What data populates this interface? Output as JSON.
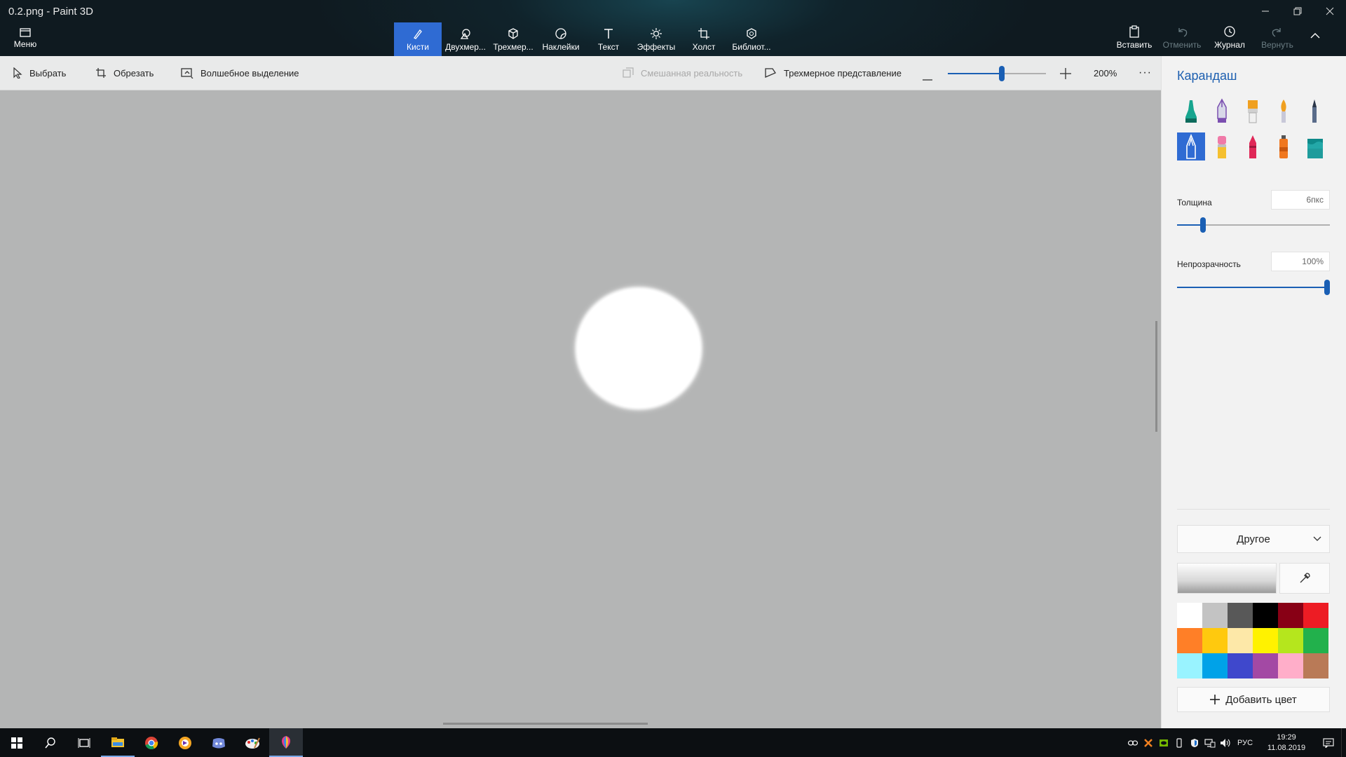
{
  "window": {
    "title": "0.2.png - Paint 3D"
  },
  "menu": {
    "label": "Меню"
  },
  "tabs": [
    {
      "label": "Кисти",
      "icon": "brush-icon",
      "active": true
    },
    {
      "label": "Двухмер...",
      "icon": "2d-shapes-icon"
    },
    {
      "label": "Трехмер...",
      "icon": "3d-shapes-icon"
    },
    {
      "label": "Наклейки",
      "icon": "stickers-icon"
    },
    {
      "label": "Текст",
      "icon": "text-icon"
    },
    {
      "label": "Эффекты",
      "icon": "effects-icon"
    },
    {
      "label": "Холст",
      "icon": "canvas-icon"
    },
    {
      "label": "Библиот...",
      "icon": "library-icon"
    }
  ],
  "commands": {
    "paste": "Вставить",
    "undo": "Отменить",
    "history": "Журнал",
    "redo": "Вернуть"
  },
  "toolbar": {
    "select": "Выбрать",
    "crop": "Обрезать",
    "magic_select": "Волшебное выделение",
    "mixed_reality": "Смешанная реальность",
    "view_3d": "Трехмерное представление",
    "zoom": "200%",
    "zoom_level": 0.55
  },
  "panel": {
    "title": "Карандаш",
    "thickness_label": "Толщина",
    "thickness_value": "6пкс",
    "thickness_level": 0.17,
    "opacity_label": "Непрозрачность",
    "opacity_value": "100%",
    "opacity_level": 1.0,
    "dropdown": "Другое",
    "add_color": "Добавить цвет",
    "brushes": [
      {
        "name": "marker-icon",
        "color": "#17a58f"
      },
      {
        "name": "calligraphy-pen-icon",
        "color": "#7b4fb0"
      },
      {
        "name": "oil-brush-icon",
        "color": "#f0a020"
      },
      {
        "name": "watercolor-icon",
        "color": "#f0a020"
      },
      {
        "name": "pixel-pen-icon",
        "color": "#5a6c8a"
      },
      {
        "name": "pencil-icon",
        "color": "#ffffff",
        "active": true
      },
      {
        "name": "eraser-icon",
        "color": "#f07aa8"
      },
      {
        "name": "crayon-icon",
        "color": "#e02858"
      },
      {
        "name": "spray-can-icon",
        "color": "#f07820"
      },
      {
        "name": "fill-bucket-icon",
        "color": "#23a8a8"
      }
    ],
    "palette": [
      "#ffffff",
      "#c3c3c3",
      "#585858",
      "#000000",
      "#880015",
      "#ed1c24",
      "#ff7f27",
      "#ffc90e",
      "#fde8a8",
      "#fff200",
      "#b5e61d",
      "#22b14c",
      "#99f3ff",
      "#00a2e8",
      "#3f48cc",
      "#a349a4",
      "#ffaec9",
      "#b97a57"
    ]
  },
  "taskbar": {
    "apps": [
      "windows-start-icon",
      "search-icon",
      "task-view-icon",
      "file-explorer-icon",
      "chrome-icon",
      "browser-icon",
      "discord-icon",
      "paint-app-icon",
      "paint-3d-icon"
    ],
    "lang": "РУС",
    "time": "19:29",
    "date": "11.08.2019"
  }
}
